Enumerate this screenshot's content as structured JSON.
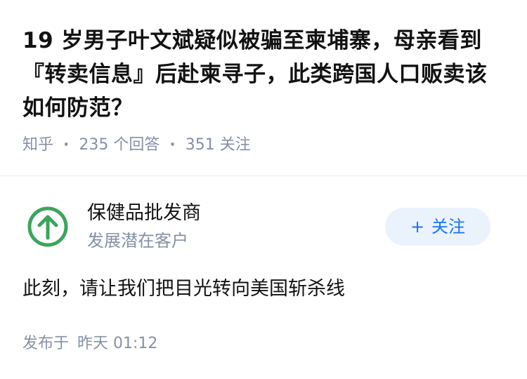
{
  "question": {
    "title": "19 岁男子叶文斌疑似被骗至柬埔寨，母亲看到『转卖信息』后赴柬寻子，此类跨国人口贩卖该如何防范？",
    "source": "知乎",
    "answer_count": "235 个回答",
    "follower_count": "351 关注",
    "separator": "·"
  },
  "author": {
    "avatar_icon": "green-circle-up-arrow-icon",
    "avatar_color": "#3aa55b",
    "name": "保健品批发商",
    "description": "发展潜在客户",
    "follow_label": "关注",
    "follow_plus": "+"
  },
  "answer": {
    "content": "此刻，请让我们把目光转向美国斩杀线",
    "posted_label": "发布于",
    "posted_time": "昨天 01:12"
  },
  "colors": {
    "accent": "#1772f6",
    "meta_gray": "#8590a6",
    "follow_bg": "#eaf2fc"
  }
}
